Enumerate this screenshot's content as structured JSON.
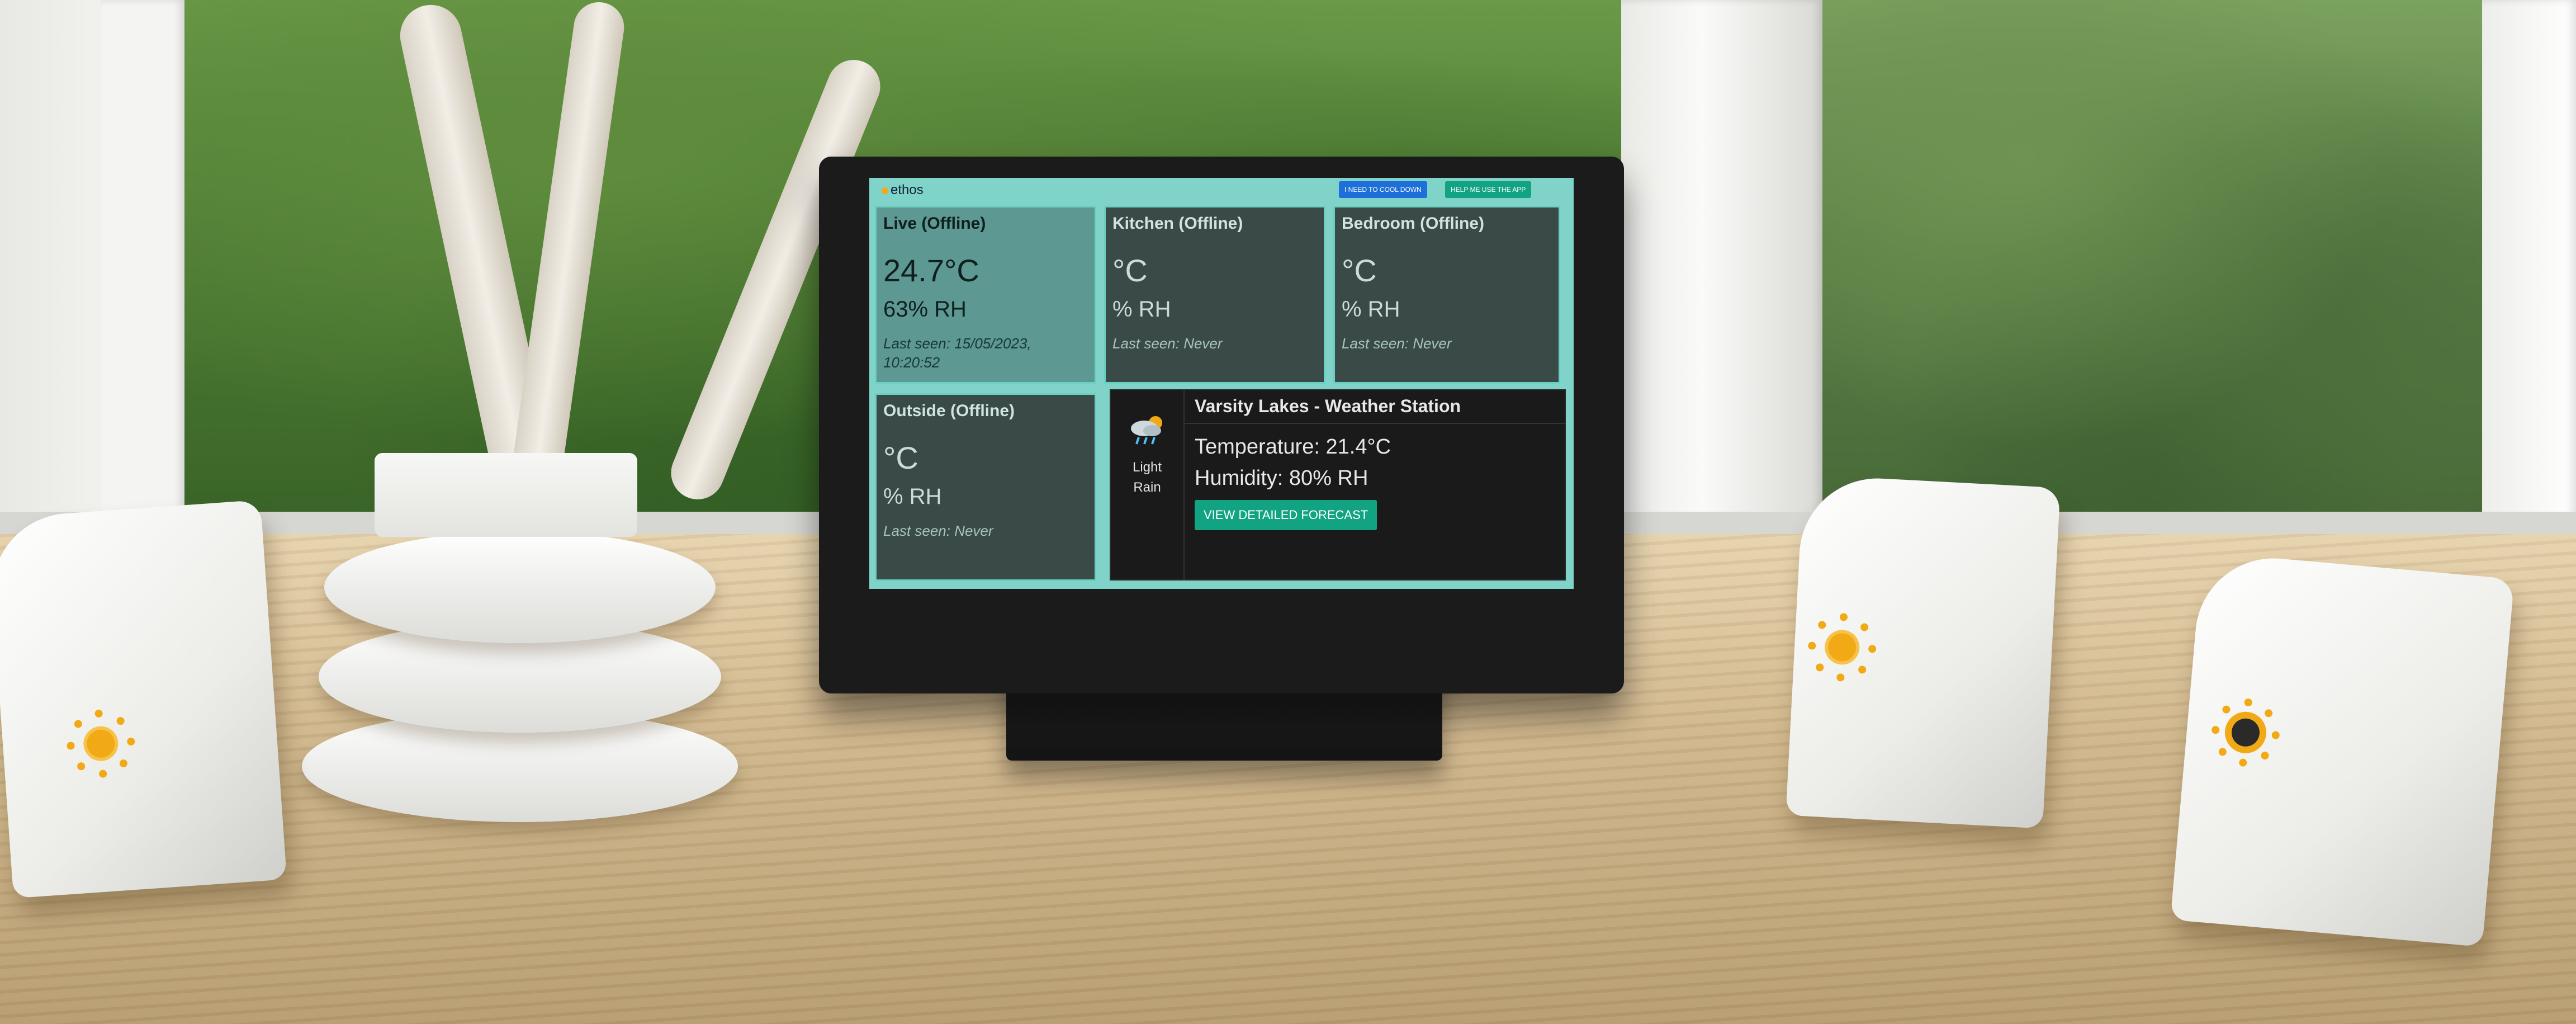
{
  "app": {
    "logo_text": "ethos"
  },
  "header": {
    "cool_down_label": "I NEED TO COOL DOWN",
    "help_label": "HELP ME USE THE APP"
  },
  "cards": {
    "live": {
      "title": "Live (Offline)",
      "temp": "24.7°C",
      "rh": "63% RH",
      "seen": "Last seen: 15/05/2023, 10:20:52"
    },
    "kitchen": {
      "title": "Kitchen (Offline)",
      "temp": "°C",
      "rh": "% RH",
      "seen": "Last seen: Never"
    },
    "bedroom": {
      "title": "Bedroom (Offline)",
      "temp": "°C",
      "rh": "% RH",
      "seen": "Last seen: Never"
    },
    "outside": {
      "title": "Outside (Offline)",
      "temp": "°C",
      "rh": "% RH",
      "seen": "Last seen: Never"
    }
  },
  "station": {
    "title": "Varsity Lakes - Weather Station",
    "condition_line1": "Light",
    "condition_line2": "Rain",
    "temperature": "Temperature: 21.4°C",
    "humidity": "Humidity: 80% RH",
    "forecast_button": "VIEW DETAILED FORECAST",
    "icon": "cloud-rain-sun-icon"
  },
  "colors": {
    "screen_bg": "#7fd3c9",
    "card_border": "#6ad0c3",
    "accent_teal": "#12a383",
    "accent_blue": "#1e6fd9",
    "sensor_led": "#f2a916"
  }
}
